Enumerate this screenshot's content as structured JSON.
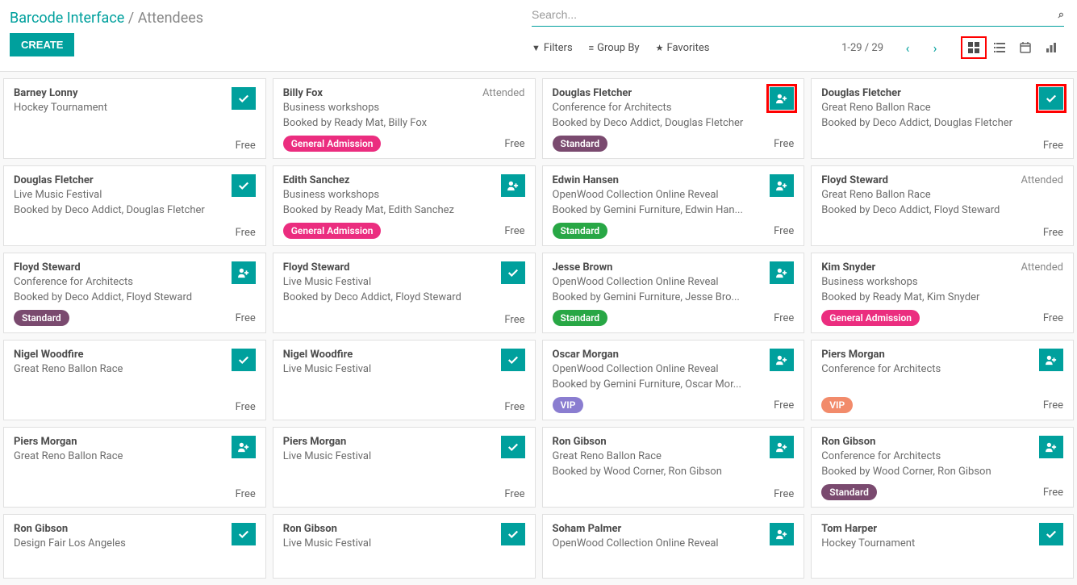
{
  "breadcrumb": {
    "app": "Barcode Interface",
    "page": "Attendees",
    "sep": "/"
  },
  "create_label": "CREATE",
  "search": {
    "placeholder": "Search..."
  },
  "controls": {
    "filters": "Filters",
    "group_by": "Group By",
    "favorites": "Favorites",
    "pager": "1-29 / 29"
  },
  "tag_colors": {
    "General Admission": "general",
    "Standard_conf": "standard-purple",
    "Standard_open": "standard-green",
    "VIP_open": "vip-purple",
    "VIP_conf": "vip-orange"
  },
  "cards": [
    {
      "name": "Barney Lonny",
      "event": "Hockey Tournament",
      "booked_by": "",
      "tag": "",
      "price": "Free",
      "action": "check",
      "status": "",
      "highlight": false
    },
    {
      "name": "Billy Fox",
      "event": "Business workshops",
      "booked_by": "Booked by Ready Mat, Billy Fox",
      "tag": "General Admission",
      "tag_class": "general",
      "price": "Free",
      "action": "none",
      "status": "Attended",
      "highlight": false
    },
    {
      "name": "Douglas Fletcher",
      "event": "Conference for Architects",
      "booked_by": "Booked by Deco Addict, Douglas Fletcher",
      "tag": "Standard",
      "tag_class": "standard-purple",
      "price": "Free",
      "action": "add",
      "status": "",
      "highlight": true
    },
    {
      "name": "Douglas Fletcher",
      "event": "Great Reno Ballon Race",
      "booked_by": "Booked by Deco Addict, Douglas Fletcher",
      "tag": "",
      "price": "Free",
      "action": "check",
      "status": "",
      "highlight": true
    },
    {
      "name": "Douglas Fletcher",
      "event": "Live Music Festival",
      "booked_by": "Booked by Deco Addict, Douglas Fletcher",
      "tag": "",
      "price": "Free",
      "action": "check",
      "status": "",
      "highlight": false
    },
    {
      "name": "Edith Sanchez",
      "event": "Business workshops",
      "booked_by": "Booked by Ready Mat, Edith Sanchez",
      "tag": "General Admission",
      "tag_class": "general",
      "price": "Free",
      "action": "add",
      "status": "",
      "highlight": false
    },
    {
      "name": "Edwin Hansen",
      "event": "OpenWood Collection Online Reveal",
      "booked_by": "Booked by Gemini Furniture, Edwin Han...",
      "tag": "Standard",
      "tag_class": "standard-green",
      "price": "Free",
      "action": "add",
      "status": "",
      "highlight": false
    },
    {
      "name": "Floyd Steward",
      "event": "Great Reno Ballon Race",
      "booked_by": "Booked by Deco Addict, Floyd Steward",
      "tag": "",
      "price": "Free",
      "action": "none",
      "status": "Attended",
      "highlight": false
    },
    {
      "name": "Floyd Steward",
      "event": "Conference for Architects",
      "booked_by": "Booked by Deco Addict, Floyd Steward",
      "tag": "Standard",
      "tag_class": "standard-purple",
      "price": "Free",
      "action": "add",
      "status": "",
      "highlight": false
    },
    {
      "name": "Floyd Steward",
      "event": "Live Music Festival",
      "booked_by": "Booked by Deco Addict, Floyd Steward",
      "tag": "",
      "price": "Free",
      "action": "check",
      "status": "",
      "highlight": false
    },
    {
      "name": "Jesse Brown",
      "event": "OpenWood Collection Online Reveal",
      "booked_by": "Booked by Gemini Furniture, Jesse Bro...",
      "tag": "Standard",
      "tag_class": "standard-green",
      "price": "Free",
      "action": "add",
      "status": "",
      "highlight": false
    },
    {
      "name": "Kim Snyder",
      "event": "Business workshops",
      "booked_by": "Booked by Ready Mat, Kim Snyder",
      "tag": "General Admission",
      "tag_class": "general",
      "price": "Free",
      "action": "none",
      "status": "Attended",
      "highlight": false
    },
    {
      "name": "Nigel Woodfire",
      "event": "Great Reno Ballon Race",
      "booked_by": "",
      "tag": "",
      "price": "Free",
      "action": "check",
      "status": "",
      "highlight": false
    },
    {
      "name": "Nigel Woodfire",
      "event": "Live Music Festival",
      "booked_by": "",
      "tag": "",
      "price": "Free",
      "action": "check",
      "status": "",
      "highlight": false
    },
    {
      "name": "Oscar Morgan",
      "event": "OpenWood Collection Online Reveal",
      "booked_by": "Booked by Gemini Furniture, Oscar Mor...",
      "tag": "VIP",
      "tag_class": "vip-purple",
      "price": "Free",
      "action": "add",
      "status": "",
      "highlight": false
    },
    {
      "name": "Piers Morgan",
      "event": "Conference for Architects",
      "booked_by": "",
      "tag": "VIP",
      "tag_class": "vip-orange",
      "price": "Free",
      "action": "add",
      "status": "",
      "highlight": false
    },
    {
      "name": "Piers Morgan",
      "event": "Great Reno Ballon Race",
      "booked_by": "",
      "tag": "",
      "price": "Free",
      "action": "add",
      "status": "",
      "highlight": false
    },
    {
      "name": "Piers Morgan",
      "event": "Live Music Festival",
      "booked_by": "",
      "tag": "",
      "price": "Free",
      "action": "check",
      "status": "",
      "highlight": false
    },
    {
      "name": "Ron Gibson",
      "event": "Great Reno Ballon Race",
      "booked_by": "Booked by Wood Corner, Ron Gibson",
      "tag": "",
      "price": "Free",
      "action": "add",
      "status": "",
      "highlight": false
    },
    {
      "name": "Ron Gibson",
      "event": "Conference for Architects",
      "booked_by": "Booked by Wood Corner, Ron Gibson",
      "tag": "Standard",
      "tag_class": "standard-purple",
      "price": "Free",
      "action": "add",
      "status": "",
      "highlight": false
    },
    {
      "name": "Ron Gibson",
      "event": "Design Fair Los Angeles",
      "booked_by": "",
      "tag": "",
      "price": "",
      "action": "check",
      "status": "",
      "highlight": false
    },
    {
      "name": "Ron Gibson",
      "event": "Live Music Festival",
      "booked_by": "",
      "tag": "",
      "price": "",
      "action": "check",
      "status": "",
      "highlight": false
    },
    {
      "name": "Soham Palmer",
      "event": "OpenWood Collection Online Reveal",
      "booked_by": "",
      "tag": "",
      "price": "",
      "action": "add",
      "status": "",
      "highlight": false
    },
    {
      "name": "Tom Harper",
      "event": "Hockey Tournament",
      "booked_by": "",
      "tag": "",
      "price": "",
      "action": "check",
      "status": "",
      "highlight": false
    }
  ]
}
